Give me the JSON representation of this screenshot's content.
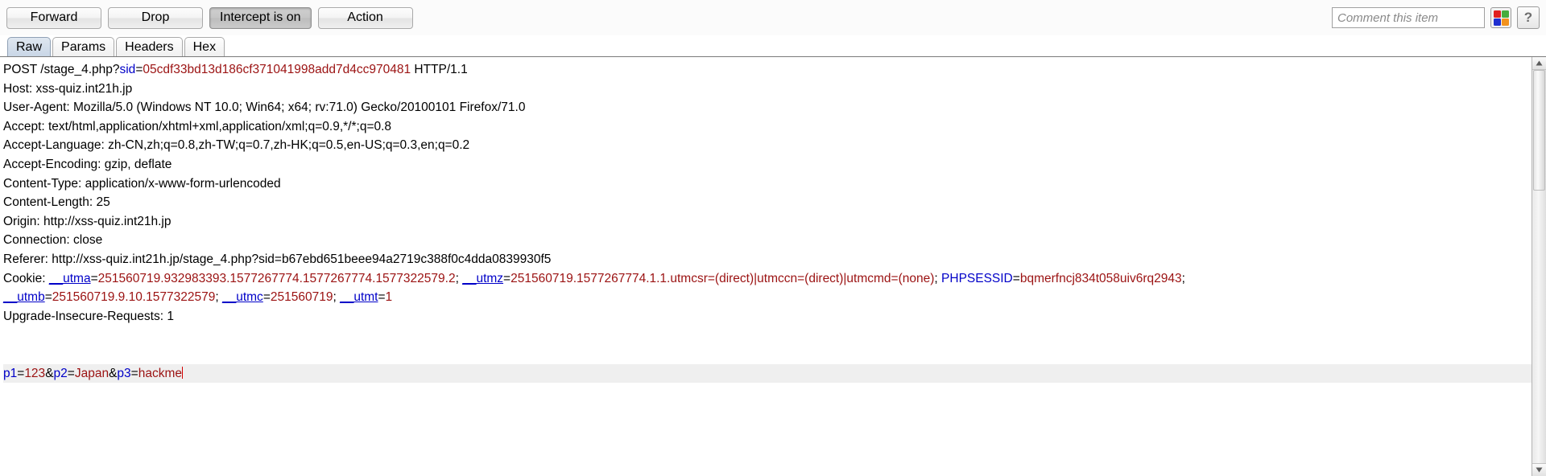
{
  "toolbar": {
    "forward_label": "Forward",
    "drop_label": "Drop",
    "intercept_label": "Intercept is on",
    "action_label": "Action",
    "comment_placeholder": "Comment this item",
    "comment_value": "",
    "highlight_icon": "color-swatch-icon",
    "highlight_colors": [
      "#e02020",
      "#46ad3c",
      "#1f2fd0",
      "#f2921d"
    ],
    "help_label": "?"
  },
  "tabs": [
    {
      "label": "Raw",
      "active": true
    },
    {
      "label": "Params",
      "active": false
    },
    {
      "label": "Headers",
      "active": false
    },
    {
      "label": "Hex",
      "active": false
    }
  ],
  "request": {
    "request_line": {
      "method_path": "POST /stage_4.php?",
      "param_name": "sid",
      "equals": "=",
      "param_value": "05cdf33bd13d186cf371041998add7d4cc970481",
      "version": " HTTP/1.1"
    },
    "headers": [
      "Host: xss-quiz.int21h.jp",
      "User-Agent: Mozilla/5.0 (Windows NT 10.0; Win64; x64; rv:71.0) Gecko/20100101 Firefox/71.0",
      "Accept: text/html,application/xhtml+xml,application/xml;q=0.9,*/*;q=0.8",
      "Accept-Language: zh-CN,zh;q=0.8,zh-TW;q=0.7,zh-HK;q=0.5,en-US;q=0.3,en;q=0.2",
      "Accept-Encoding: gzip, deflate",
      "Content-Type: application/x-www-form-urlencoded",
      "Content-Length: 25",
      "Origin: http://xss-quiz.int21h.jp",
      "Connection: close",
      "Referer: http://xss-quiz.int21h.jp/stage_4.php?sid=b67ebd651beee94a2719c388f0c4dda0839930f5"
    ],
    "cookie_label": "Cookie: ",
    "cookie_line1": [
      {
        "text": "__utma",
        "style": "blue-underline"
      },
      {
        "text": "=",
        "style": "black"
      },
      {
        "text": "251560719.932983393.1577267774.1577267774.1577322579.2",
        "style": "red"
      },
      {
        "text": "; ",
        "style": "black"
      },
      {
        "text": "__utmz",
        "style": "blue-underline"
      },
      {
        "text": "=",
        "style": "black"
      },
      {
        "text": "251560719.1577267774.1.1.utmcsr=(direct)|utmccn=(direct)|utmcmd=(none)",
        "style": "red"
      },
      {
        "text": "; ",
        "style": "black"
      },
      {
        "text": "PHPSESSID",
        "style": "blue"
      },
      {
        "text": "=",
        "style": "black"
      },
      {
        "text": "bqmerfncj834t058uiv6rq2943",
        "style": "red"
      },
      {
        "text": ";",
        "style": "black"
      }
    ],
    "cookie_line2": [
      {
        "text": "__utmb",
        "style": "blue-underline"
      },
      {
        "text": "=",
        "style": "black"
      },
      {
        "text": "251560719.9.10.1577322579",
        "style": "red"
      },
      {
        "text": "; ",
        "style": "black"
      },
      {
        "text": "__utmc",
        "style": "blue-underline"
      },
      {
        "text": "=",
        "style": "black"
      },
      {
        "text": "251560719",
        "style": "red"
      },
      {
        "text": "; ",
        "style": "black"
      },
      {
        "text": "__utmt",
        "style": "blue-underline"
      },
      {
        "text": "=",
        "style": "black"
      },
      {
        "text": "1",
        "style": "red"
      }
    ],
    "trailing_headers": [
      "Upgrade-Insecure-Requests: 1"
    ],
    "body": [
      {
        "text": "p1",
        "style": "blue"
      },
      {
        "text": "=",
        "style": "black"
      },
      {
        "text": "123",
        "style": "red"
      },
      {
        "text": "&",
        "style": "black"
      },
      {
        "text": "p2",
        "style": "blue"
      },
      {
        "text": "=",
        "style": "black"
      },
      {
        "text": "Japan",
        "style": "red"
      },
      {
        "text": "&",
        "style": "black"
      },
      {
        "text": "p3",
        "style": "blue"
      },
      {
        "text": "=",
        "style": "black"
      },
      {
        "text": "hackme",
        "style": "red"
      }
    ]
  },
  "scrollbar": {
    "up_arrow_icon": "triangle-up-icon",
    "down_arrow_icon": "triangle-down-icon"
  }
}
